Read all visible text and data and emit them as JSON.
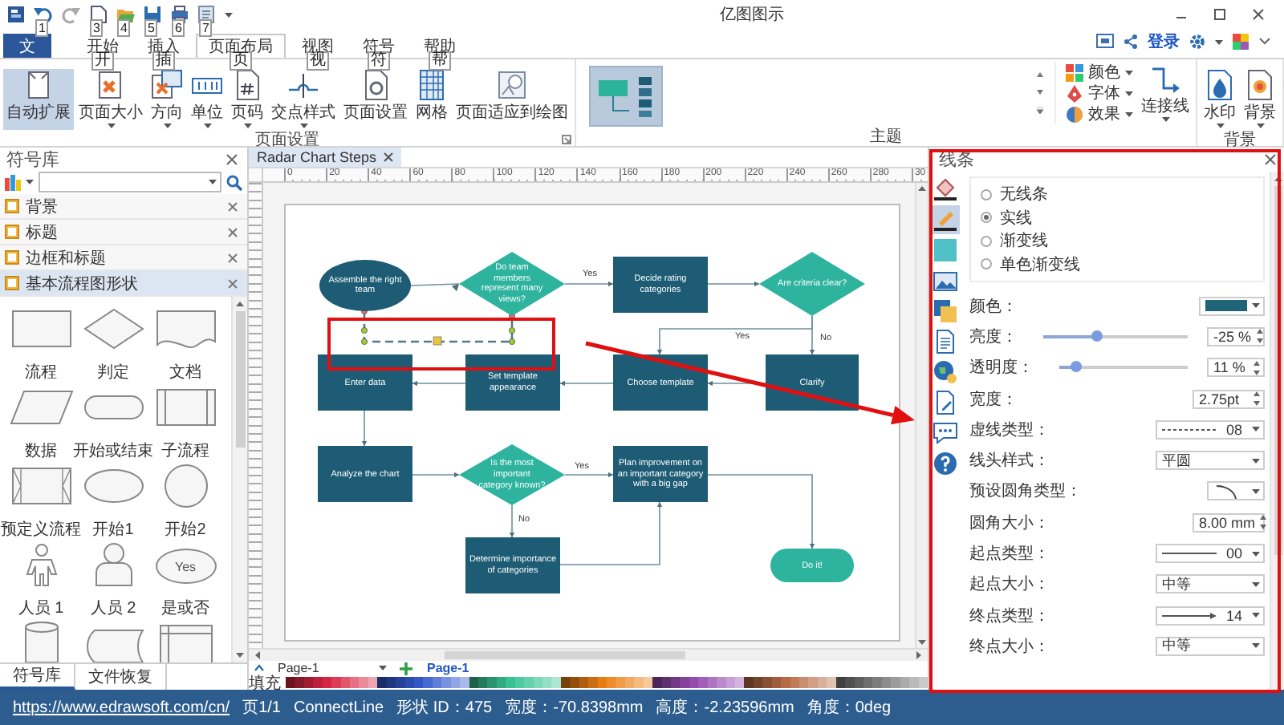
{
  "title_bar": {
    "title": "亿图图示",
    "quick_access": [
      {
        "kind": "undo",
        "keytip": "1"
      },
      {
        "kind": "redo"
      },
      {
        "kind": "new",
        "keytip": "3"
      },
      {
        "kind": "open",
        "keytip": "4"
      },
      {
        "kind": "save",
        "keytip": "5"
      },
      {
        "kind": "print",
        "keytip": "6"
      },
      {
        "kind": "export",
        "keytip": "7"
      }
    ]
  },
  "ribbon_tabs": [
    {
      "label": "文",
      "kind": "file",
      "selected": false
    },
    {
      "label": "开始",
      "keytip": "开",
      "selected": false
    },
    {
      "label": "插入",
      "keytip": "插",
      "selected": false
    },
    {
      "label": "页面布局",
      "keytip": "页",
      "selected": true
    },
    {
      "label": "视图",
      "keytip": "视",
      "selected": false
    },
    {
      "label": "符号",
      "keytip": "符",
      "selected": false
    },
    {
      "label": "帮助",
      "keytip": "帮",
      "selected": false
    }
  ],
  "account": {
    "login": "登录"
  },
  "ribbon_groups": [
    {
      "label": "页面设置",
      "buttons": [
        {
          "label": "自动扩展",
          "dropdown": false,
          "selected": true
        },
        {
          "label": "页面大小",
          "dropdown": true,
          "selected": false
        },
        {
          "label": "方向",
          "dropdown": true,
          "selected": false
        },
        {
          "label": "单位",
          "dropdown": true,
          "selected": false
        },
        {
          "label": "页码",
          "dropdown": true,
          "selected": false
        },
        {
          "label": "交点样式",
          "dropdown": true,
          "selected": false
        },
        {
          "label": "页面设置",
          "dropdown": false,
          "selected": false
        },
        {
          "label": "网格",
          "dropdown": false,
          "selected": false
        },
        {
          "label": "页面适应到绘图",
          "dropdown": false,
          "selected": false
        }
      ]
    },
    {
      "label": "主题",
      "kind": "theme",
      "small_buttons": [
        {
          "label": "颜色"
        },
        {
          "label": "字体"
        },
        {
          "label": "效果"
        }
      ],
      "buttons": [
        {
          "label": "连接线",
          "dropdown": true,
          "selected": false
        }
      ]
    },
    {
      "label": "背景",
      "buttons": [
        {
          "label": "水印",
          "dropdown": true,
          "selected": false
        },
        {
          "label": "背景",
          "dropdown": true,
          "selected": false
        }
      ]
    }
  ],
  "symbol_library": {
    "title": "符号库",
    "categories": [
      {
        "label": "背景",
        "selected": false
      },
      {
        "label": "标题",
        "selected": false
      },
      {
        "label": "边框和标题",
        "selected": false
      },
      {
        "label": "基本流程图形状",
        "selected": true
      }
    ],
    "shape_rows": [
      [
        {
          "label": "流程"
        },
        {
          "label": "判定"
        },
        {
          "label": "文档"
        }
      ],
      [
        {
          "label": "数据"
        },
        {
          "label": "开始或结束"
        },
        {
          "label": "子流程"
        }
      ],
      [
        {
          "label": "预定义流程"
        },
        {
          "label": "开始1"
        },
        {
          "label": "开始2"
        }
      ],
      [
        {
          "label": "人员 1"
        },
        {
          "label": "人员 2"
        },
        {
          "label": "是或否",
          "text": "Yes"
        }
      ]
    ],
    "tabs": [
      {
        "label": "符号库",
        "selected": true
      },
      {
        "label": "文件恢复",
        "selected": false
      }
    ]
  },
  "document": {
    "tab": "Radar Chart Steps",
    "ruler": [
      "0",
      "20",
      "40",
      "60",
      "80",
      "100",
      "120",
      "140",
      "160",
      "180",
      "200",
      "220",
      "240",
      "260",
      "280",
      "30"
    ],
    "nodes": [
      {
        "kind": "ellipse",
        "text": "Assemble the right team"
      },
      {
        "kind": "decision",
        "text": "Do team members represent many views?"
      },
      {
        "kind": "process",
        "text": "Decide rating categories"
      },
      {
        "kind": "decision",
        "text": "Are criteria clear?"
      },
      {
        "kind": "process",
        "text": "Enter data"
      },
      {
        "kind": "process",
        "text": "Set template appearance"
      },
      {
        "kind": "process",
        "text": "Choose template"
      },
      {
        "kind": "process",
        "text": "Clarify"
      },
      {
        "kind": "process",
        "text": "Analyze the chart"
      },
      {
        "kind": "decision",
        "text": "Is the most important category known?"
      },
      {
        "kind": "process",
        "text": "Plan improvement on an important category with a big gap"
      },
      {
        "kind": "process",
        "text": "Determine importance of categories"
      },
      {
        "kind": "terminator",
        "text": "Do it!"
      }
    ],
    "edges": [
      {
        "selected": false
      },
      {
        "label": "Yes",
        "selected": false
      },
      {
        "selected": false
      },
      {
        "label": "Yes",
        "selected": false
      },
      {
        "label": "No",
        "selected": false
      },
      {
        "selected": false
      },
      {
        "selected": false
      },
      {
        "selected": false
      },
      {
        "selected": false
      },
      {
        "selected": false
      },
      {
        "label": "Yes",
        "selected": false
      },
      {
        "label": "No",
        "selected": false
      },
      {
        "selected": false
      },
      {
        "selected": false
      },
      {
        "selected": true
      }
    ],
    "page_dropdown": "Page-1",
    "pages": [
      {
        "label": "Page-1",
        "selected": true
      }
    ],
    "fill_label": "填充"
  },
  "format_panel": {
    "title": "线条",
    "side_icons": [
      {
        "selected": false
      },
      {
        "selected": true
      },
      {
        "selected": false
      },
      {
        "selected": false
      },
      {
        "selected": false
      },
      {
        "selected": false
      },
      {
        "selected": false
      },
      {
        "selected": false
      },
      {
        "selected": false
      },
      {
        "selected": false
      }
    ],
    "line_types": [
      {
        "label": "无线条",
        "selected": false
      },
      {
        "label": "实线",
        "selected": true
      },
      {
        "label": "渐变线",
        "selected": false
      },
      {
        "label": "单色渐变线",
        "selected": false
      }
    ],
    "properties": [
      {
        "label": "颜色：",
        "kind": "color",
        "color": "#1f6477"
      },
      {
        "label": "亮度：",
        "kind": "slider",
        "level": 0.37,
        "value": "-25 %"
      },
      {
        "label": "透明度：",
        "kind": "slider",
        "level": 0.13,
        "value": "11 %"
      },
      {
        "label": "宽度：",
        "kind": "spin",
        "value": "2.75pt"
      },
      {
        "label": "虚线类型：",
        "kind": "line-select",
        "value": "08"
      },
      {
        "label": "线头样式：",
        "kind": "select",
        "value": "平圆"
      },
      {
        "label": "预设圆角类型：",
        "kind": "curve-select"
      },
      {
        "label": "圆角大小：",
        "kind": "spin",
        "value": "8.00 mm"
      },
      {
        "label": "起点类型：",
        "kind": "line-select",
        "value": "00"
      },
      {
        "label": "起点大小：",
        "kind": "select",
        "value": "中等"
      },
      {
        "label": "终点类型：",
        "kind": "line-select",
        "value": "14"
      },
      {
        "label": "终点大小：",
        "kind": "select",
        "value": "中等"
      }
    ]
  },
  "status_bar": {
    "link": "https://www.edrawsoft.com/cn/",
    "items": [
      "页1/1",
      "ConnectLine",
      "形状 ID：475",
      "宽度：-70.8398mm",
      "高度：-2.23596mm",
      "角度：0deg"
    ]
  },
  "annotations": [
    {
      "kind": "frame"
    },
    {
      "kind": "arrow"
    },
    {
      "kind": "frame"
    }
  ]
}
